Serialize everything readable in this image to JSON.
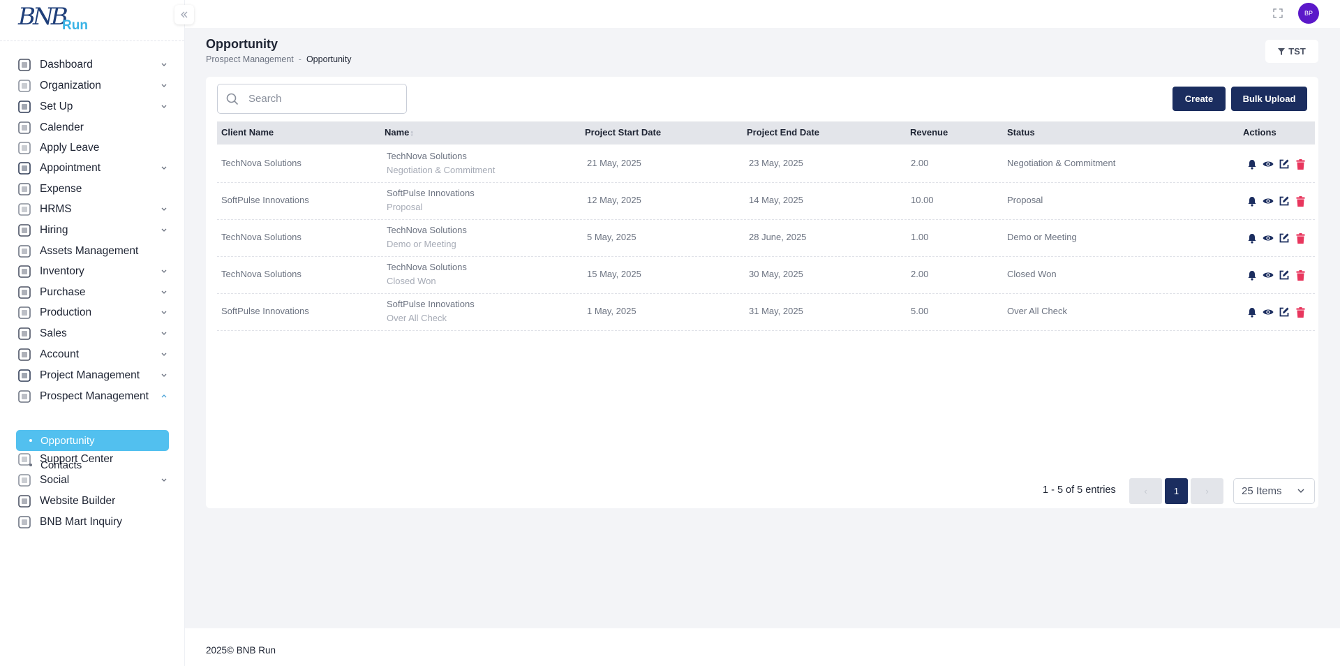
{
  "brand": {
    "logo_letters": "BNB",
    "logo_word": "Run"
  },
  "sidebar": {
    "items": [
      {
        "label": "Dashboard",
        "icon": "dashboard-icon",
        "chevron": true
      },
      {
        "label": "Organization",
        "icon": "organization-icon",
        "chevron": true
      },
      {
        "label": "Set Up",
        "icon": "setup-icon",
        "chevron": true
      },
      {
        "label": "Calender",
        "icon": "hourglass-icon",
        "chevron": false
      },
      {
        "label": "Apply Leave",
        "icon": "leave-icon",
        "chevron": false
      },
      {
        "label": "Appointment",
        "icon": "calendar-icon",
        "chevron": true
      },
      {
        "label": "Expense",
        "icon": "expense-icon",
        "chevron": false
      },
      {
        "label": "HRMS",
        "icon": "hrms-icon",
        "chevron": true
      },
      {
        "label": "Hiring",
        "icon": "hiring-icon",
        "chevron": true
      },
      {
        "label": "Assets Management",
        "icon": "assets-icon",
        "chevron": false
      },
      {
        "label": "Inventory",
        "icon": "inventory-icon",
        "chevron": true
      },
      {
        "label": "Purchase",
        "icon": "cart-icon",
        "chevron": true
      },
      {
        "label": "Production",
        "icon": "production-icon",
        "chevron": true
      },
      {
        "label": "Sales",
        "icon": "sales-icon",
        "chevron": true
      },
      {
        "label": "Account",
        "icon": "bank-icon",
        "chevron": true
      },
      {
        "label": "Project Management",
        "icon": "project-icon",
        "chevron": true
      },
      {
        "label": "Prospect Management",
        "icon": "prospect-icon",
        "chevron": true,
        "expanded": true
      },
      {
        "label": "Support Center",
        "icon": "support-icon",
        "chevron": false
      },
      {
        "label": "Social",
        "icon": "social-icon",
        "chevron": true
      },
      {
        "label": "Website Builder",
        "icon": "website-icon",
        "chevron": false
      },
      {
        "label": "BNB Mart Inquiry",
        "icon": "store-icon",
        "chevron": false
      }
    ],
    "sub_items": [
      {
        "label": "Opportunity",
        "active": true
      },
      {
        "label": "Contacts",
        "active": false
      }
    ]
  },
  "header": {
    "avatar_initials": "BP"
  },
  "page": {
    "title": "Opportunity",
    "breadcrumb": [
      "Prospect Management",
      "Opportunity"
    ],
    "filter_label": "TST"
  },
  "toolbar": {
    "search_placeholder": "Search",
    "create_label": "Create",
    "bulk_upload_label": "Bulk Upload"
  },
  "table": {
    "columns": [
      "Client Name",
      "Name",
      "Project Start Date",
      "Project End Date",
      "Revenue",
      "Status",
      "Actions"
    ],
    "rows": [
      {
        "client": "TechNova Solutions",
        "name": "TechNova Solutions",
        "stage": "Negotiation & Commitment",
        "start": "21 May, 2025",
        "end": "23 May, 2025",
        "revenue": "2.00",
        "status": "Negotiation & Commitment"
      },
      {
        "client": "SoftPulse Innovations",
        "name": "SoftPulse Innovations",
        "stage": "Proposal",
        "start": "12 May, 2025",
        "end": "14 May, 2025",
        "revenue": "10.00",
        "status": "Proposal"
      },
      {
        "client": "TechNova Solutions",
        "name": "TechNova Solutions",
        "stage": "Demo or Meeting",
        "start": "5 May, 2025",
        "end": "28 June, 2025",
        "revenue": "1.00",
        "status": "Demo or Meeting"
      },
      {
        "client": "TechNova Solutions",
        "name": "TechNova Solutions",
        "stage": "Closed Won",
        "start": "15 May, 2025",
        "end": "30 May, 2025",
        "revenue": "2.00",
        "status": "Closed Won"
      },
      {
        "client": "SoftPulse Innovations",
        "name": "SoftPulse Innovations",
        "stage": "Over All Check",
        "start": "1 May, 2025",
        "end": "31 May, 2025",
        "revenue": "5.00",
        "status": "Over All Check"
      }
    ]
  },
  "pagination": {
    "entries_text": "1 - 5 of 5 entries",
    "prev_label": "‹",
    "current_page": "1",
    "next_label": "›",
    "items_per_page": "25 Items"
  },
  "colors": {
    "navy": "#1b2d5f",
    "accent": "#52c0ef",
    "danger": "#e8365d",
    "avatar": "#5b18c9"
  },
  "footer": {
    "text": "2025© BNB Run"
  }
}
